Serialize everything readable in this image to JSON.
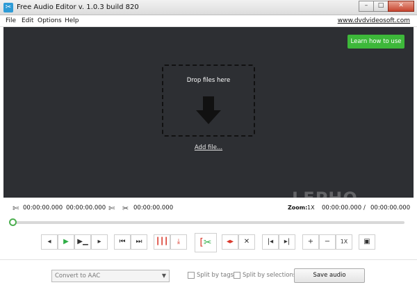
{
  "window": {
    "title": "Free Audio Editor v. 1.0.3 build 820",
    "minimize": "–",
    "maximize": "□",
    "close": "✕"
  },
  "menu": {
    "items": [
      "File",
      "Edit",
      "Options",
      "Help"
    ],
    "site_link": "www.dvdvideosoft.com"
  },
  "drop_area": {
    "learn_button": "Learn how to use",
    "drop_text": "Drop files here",
    "add_file_link": "Add file..."
  },
  "watermark": "LEPHO",
  "time": {
    "start": "00:00:00.000",
    "end": "00:00:00.000",
    "selection": "00:00:00.000",
    "zoom_label": "Zoom:",
    "zoom_value": "1X",
    "range_from": "00:00:00.000",
    "range_sep": "/",
    "range_to": "00:00:00.000"
  },
  "timeline": {
    "position": 0
  },
  "toolbar": {
    "speed": "1X"
  },
  "bottom": {
    "format_value": "Convert to AAC",
    "split_tags": "Split by tags",
    "split_selections": "Split by selections",
    "save_button": "Save audio"
  },
  "colors": {
    "accent_green": "#3db83a",
    "drop_area_bg": "#2d2f33",
    "cut_red": "#d9382b"
  }
}
